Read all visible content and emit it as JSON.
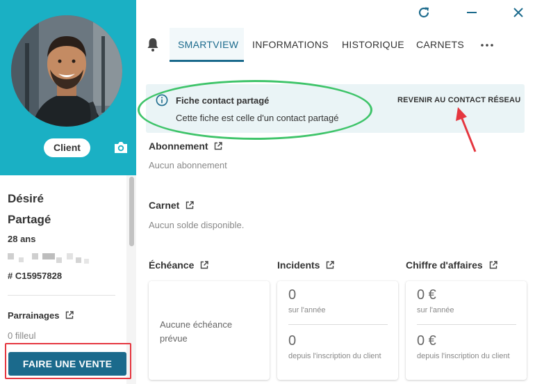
{
  "sidebar": {
    "badge": "Client",
    "first_name": "Désiré",
    "last_name": "Partagé",
    "age": "28 ans",
    "client_id": "# C15957828",
    "sponsorship_title": "Parrainages",
    "sponsorship_value": "0 filleul",
    "sale_button": "FAIRE UNE VENTE"
  },
  "tabs": [
    {
      "label": "SMARTVIEW",
      "active": true
    },
    {
      "label": "INFORMATIONS",
      "active": false
    },
    {
      "label": "HISTORIQUE",
      "active": false
    },
    {
      "label": "CARNETS",
      "active": false
    }
  ],
  "alert": {
    "title": "Fiche contact partagé",
    "text": "Cette fiche est celle d'un contact partagé",
    "link": "REVENIR AU CONTACT RÉSEAU"
  },
  "sections": {
    "subscription": {
      "title": "Abonnement",
      "value": "Aucun abonnement"
    },
    "carnet": {
      "title": "Carnet",
      "value": "Aucun solde disponible."
    },
    "due": {
      "title": "Échéance",
      "empty": "Aucune échéance prévue"
    },
    "incidents": {
      "title": "Incidents",
      "year_value": "0",
      "year_label": "sur l'année",
      "total_value": "0",
      "total_label": "depuis l'inscription du client"
    },
    "turnover": {
      "title": "Chiffre d'affaires",
      "year_value": "0 €",
      "year_label": "sur l'année",
      "total_value": "0 €",
      "total_label": "depuis l'inscription du client"
    }
  },
  "colors": {
    "accent": "#1b6a8c",
    "profile_bg": "#1ab0c4",
    "alert_bg": "#eaf4f6",
    "annotation_green": "#3fc46a",
    "annotation_red": "#e5363f"
  },
  "icons": [
    "camera-icon",
    "external-link-icon",
    "refresh-icon",
    "minimize-icon",
    "close-icon",
    "bell-icon",
    "more-icon",
    "info-icon"
  ]
}
